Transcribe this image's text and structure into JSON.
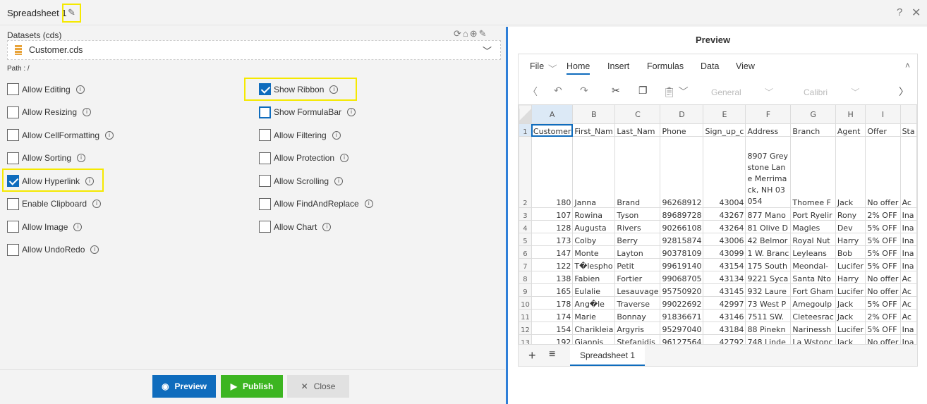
{
  "title": "Spreadsheet 1",
  "datasets_label": "Datasets (cds)",
  "dataset_value": "Customer.cds",
  "path_label": "Path : /",
  "options_left": [
    {
      "label": "Allow Editing",
      "checked": false
    },
    {
      "label": "Allow Resizing",
      "checked": false
    },
    {
      "label": "Allow CellFormatting",
      "checked": false
    },
    {
      "label": "Allow Sorting",
      "checked": false
    },
    {
      "label": "Allow Hyperlink",
      "checked": true
    },
    {
      "label": "Enable Clipboard",
      "checked": false
    },
    {
      "label": "Allow Image",
      "checked": false
    },
    {
      "label": "Allow UndoRedo",
      "checked": false
    }
  ],
  "options_right": [
    {
      "label": "Show Ribbon",
      "checked": true
    },
    {
      "label": "Show FormulaBar",
      "checked": false
    },
    {
      "label": "Allow Filtering",
      "checked": false
    },
    {
      "label": "Allow Protection",
      "checked": false
    },
    {
      "label": "Allow Scrolling",
      "checked": false
    },
    {
      "label": "Allow FindAndReplace",
      "checked": false
    },
    {
      "label": "Allow Chart",
      "checked": false
    }
  ],
  "buttons": {
    "preview": "Preview",
    "publish": "Publish",
    "close": "Close"
  },
  "preview_title": "Preview",
  "ribbon": {
    "tabs": [
      "File",
      "Home",
      "Insert",
      "Formulas",
      "Data",
      "View"
    ],
    "active": "Home",
    "number_format": "General",
    "font": "Calibri"
  },
  "grid": {
    "columns": [
      "A",
      "B",
      "C",
      "D",
      "E",
      "F",
      "G",
      "H",
      "I",
      ""
    ],
    "rows": [
      [
        "Customer",
        "First_Nam",
        "Last_Nam",
        "Phone",
        "Sign_up_c",
        "Address",
        "Branch",
        "Agent",
        "Offer",
        "Sta"
      ],
      [
        "180",
        "Janna",
        "Brand",
        "96268912",
        "43004",
        "8907 Greystone Lane Merrimack, NH 03054",
        "Thomee F",
        "Jack",
        "No offer",
        "Ac"
      ],
      [
        "107",
        "Rowina",
        "Tyson",
        "89689728",
        "43267",
        "877 Mano",
        "Port Ryelir",
        "Rony",
        "2% OFF",
        "Ina"
      ],
      [
        "128",
        "Augusta",
        "Rivers",
        "90266108",
        "43264",
        "81 Olive D",
        "Magles",
        "Dev",
        "5% OFF",
        "Ina"
      ],
      [
        "173",
        "Colby",
        "Berry",
        "92815874",
        "43006",
        "42 Belmor",
        "Royal Nut",
        "Harry",
        "5% OFF",
        "Ina"
      ],
      [
        "147",
        "Monte",
        "Layton",
        "90378109",
        "43099",
        "1 W. Branc",
        "Leyleans",
        "Bob",
        "5% OFF",
        "Ina"
      ],
      [
        "122",
        "T�lespho",
        "Petit",
        "99619140",
        "43154",
        "175 South",
        "Meondal-",
        "Lucifer",
        "5% OFF",
        "Ina"
      ],
      [
        "138",
        "Fabien",
        "Fortier",
        "99068705",
        "43134",
        "9221 Syca",
        "Santa Nto",
        "Harry",
        "No offer",
        "Ac"
      ],
      [
        "165",
        "Eulalie",
        "Lesauvage",
        "95750920",
        "43145",
        "932 Laure",
        "Fort Gham",
        "Lucifer",
        "No offer",
        "Ac"
      ],
      [
        "178",
        "Ang�le",
        "Traverse",
        "99022692",
        "42997",
        "73 West P",
        "Amegoulp",
        "Jack",
        "5% OFF",
        "Ac"
      ],
      [
        "174",
        "Marie",
        "Bonnay",
        "91836671",
        "43146",
        "7511 SW.",
        "Cleteesrac",
        "Jack",
        "2% OFF",
        "Ac"
      ],
      [
        "154",
        "Charikleia",
        "Argyris",
        "95297040",
        "43184",
        "88 Pinekn",
        "Narinessh",
        "Lucifer",
        "5% OFF",
        "Ina"
      ],
      [
        "192",
        "Giannis",
        "Stefanidis",
        "96127564",
        "42792",
        "748 Linde",
        "La Wstonc",
        "Jack",
        "No offer",
        "Ina"
      ]
    ]
  },
  "sheet_tab": "Spreadsheet 1",
  "colors": {
    "accent": "#0f6cbd",
    "publish": "#3cb521",
    "highlight": "#f5e900"
  }
}
